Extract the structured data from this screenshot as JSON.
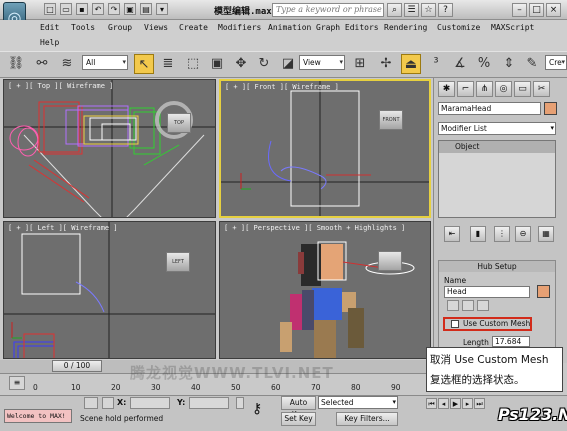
{
  "titlebar": {
    "title": "模型编辑.max",
    "search_placeholder": "Type a keyword or phrase",
    "help_label": "?"
  },
  "menu": [
    "Edit",
    "Tools",
    "Group",
    "Views",
    "Create",
    "Modifiers",
    "Animation",
    "Graph Editors",
    "Rendering",
    "Customize",
    "MAXScript",
    "Help"
  ],
  "toolbar": {
    "filter_value": "All",
    "refcoord_value": "View",
    "namedsel_value": "Cre"
  },
  "viewports": {
    "top": "[ + ][ Top ][ Wireframe ]",
    "front": "[ + ][ Front ][ Wireframe ]",
    "left": "[ + ][ Left ][ Wireframe ]",
    "perspective": "[ + ][ Perspective ][ Smooth + Highlights ]",
    "cube_top": "TOP",
    "cube_front": "FRONT",
    "cube_left": "LEFT"
  },
  "command_panel": {
    "object_name": "MaramaHead",
    "modifier_list": "Modifier List",
    "stack_item": "Object",
    "rollout_title": "Hub Setup",
    "name_label": "Name",
    "name_value": "Head",
    "use_custom_mesh_label": "Use Custom Mesh",
    "use_custom_mesh_checked": false,
    "length_label": "Length",
    "length_value": "17.684",
    "object_color": "#e6a074"
  },
  "annotation": {
    "line1": "取消 Use Custom Mesh",
    "line2": "复选框的选择状态。"
  },
  "timeline": {
    "slider": "0 / 100",
    "ticks": [
      "0",
      "10",
      "20",
      "30",
      "40",
      "50",
      "60",
      "70",
      "80",
      "90"
    ]
  },
  "status": {
    "welcome": "Welcome to MAX!",
    "message": "Scene hold performed",
    "x_label": "X:",
    "y_label": "Y:",
    "auto_key": "Auto Key",
    "set_key": "Set Key",
    "selected": "Selected",
    "key_filters": "Key Filters..."
  },
  "watermarks": {
    "site": "腾龙视觉WWW.TLVI.NET",
    "badge": "Ps123.Net"
  }
}
